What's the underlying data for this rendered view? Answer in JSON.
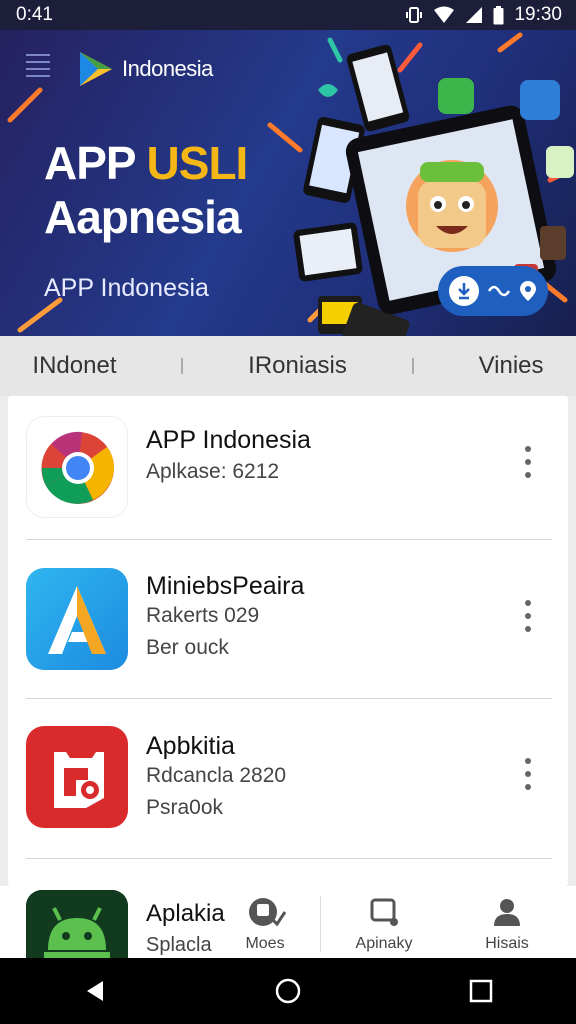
{
  "status_bar": {
    "time_left": "0:41",
    "time_right": "19:30"
  },
  "banner": {
    "brand_name": "Indonesia",
    "title_line1_a": "APP",
    "title_line1_b": "USLI",
    "title_line2": "Aapnesia",
    "subtitle": "APP Indonesia",
    "colors": {
      "accent": "#f5b716",
      "background": "#243a8c",
      "pill": "#1e5fbf"
    }
  },
  "tabs": [
    {
      "label": "INdonet"
    },
    {
      "label": "IRoniasis"
    },
    {
      "label": "Vinies"
    }
  ],
  "apps": [
    {
      "name": "APP Indonesia",
      "meta1": "Aplkase: 6212",
      "meta2": "",
      "icon": "chrome-icon"
    },
    {
      "name": "MiniebsPeaira",
      "meta1": "Rakerts 029",
      "meta2": "Ber ouck",
      "icon": "a-letter-icon"
    },
    {
      "name": "Apbkitia",
      "meta1": "Rdcancla 2820",
      "meta2": "Psra0ok",
      "icon": "red-app-icon"
    }
  ],
  "partial_app": {
    "name": "Aplakia",
    "meta": "Splacla",
    "icon": "android-icon"
  },
  "bottom_nav": [
    {
      "label": "Moes",
      "icon": "app-badge-icon"
    },
    {
      "label": "Apinaky",
      "icon": "device-icon"
    },
    {
      "label": "Hisais",
      "icon": "person-icon"
    }
  ]
}
